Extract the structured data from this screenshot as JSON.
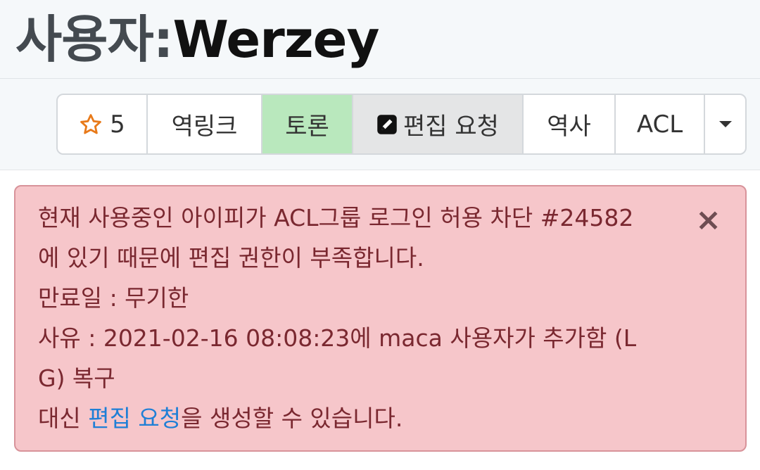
{
  "title": {
    "namespace": "사용자:",
    "name": "Werzey"
  },
  "toolbar": {
    "star_count": "5",
    "backlinks": "역링크",
    "discuss": "토론",
    "edit_request": "편집 요청",
    "history": "역사",
    "acl": "ACL"
  },
  "alert": {
    "line1": "현재 사용중인 아이피가 ACL그룹 로그인 허용 차단 #24582",
    "line2": "에 있기 때문에 편집 권한이 부족합니다.",
    "line3": "만료일 : 무기한",
    "line4": "사유 : 2021-02-16 08:08:23에 maca 사용자가 추가함 (L",
    "line5": "G) 복구",
    "line6_prefix": "대신 ",
    "line6_link": "편집 요청",
    "line6_suffix": "을 생성할 수 있습니다.",
    "close": "×"
  },
  "colors": {
    "discuss_bg": "#b9e8bd",
    "alert_bg": "#f6c6ca",
    "link": "#1f7fd6",
    "star": "#e87a1a"
  }
}
